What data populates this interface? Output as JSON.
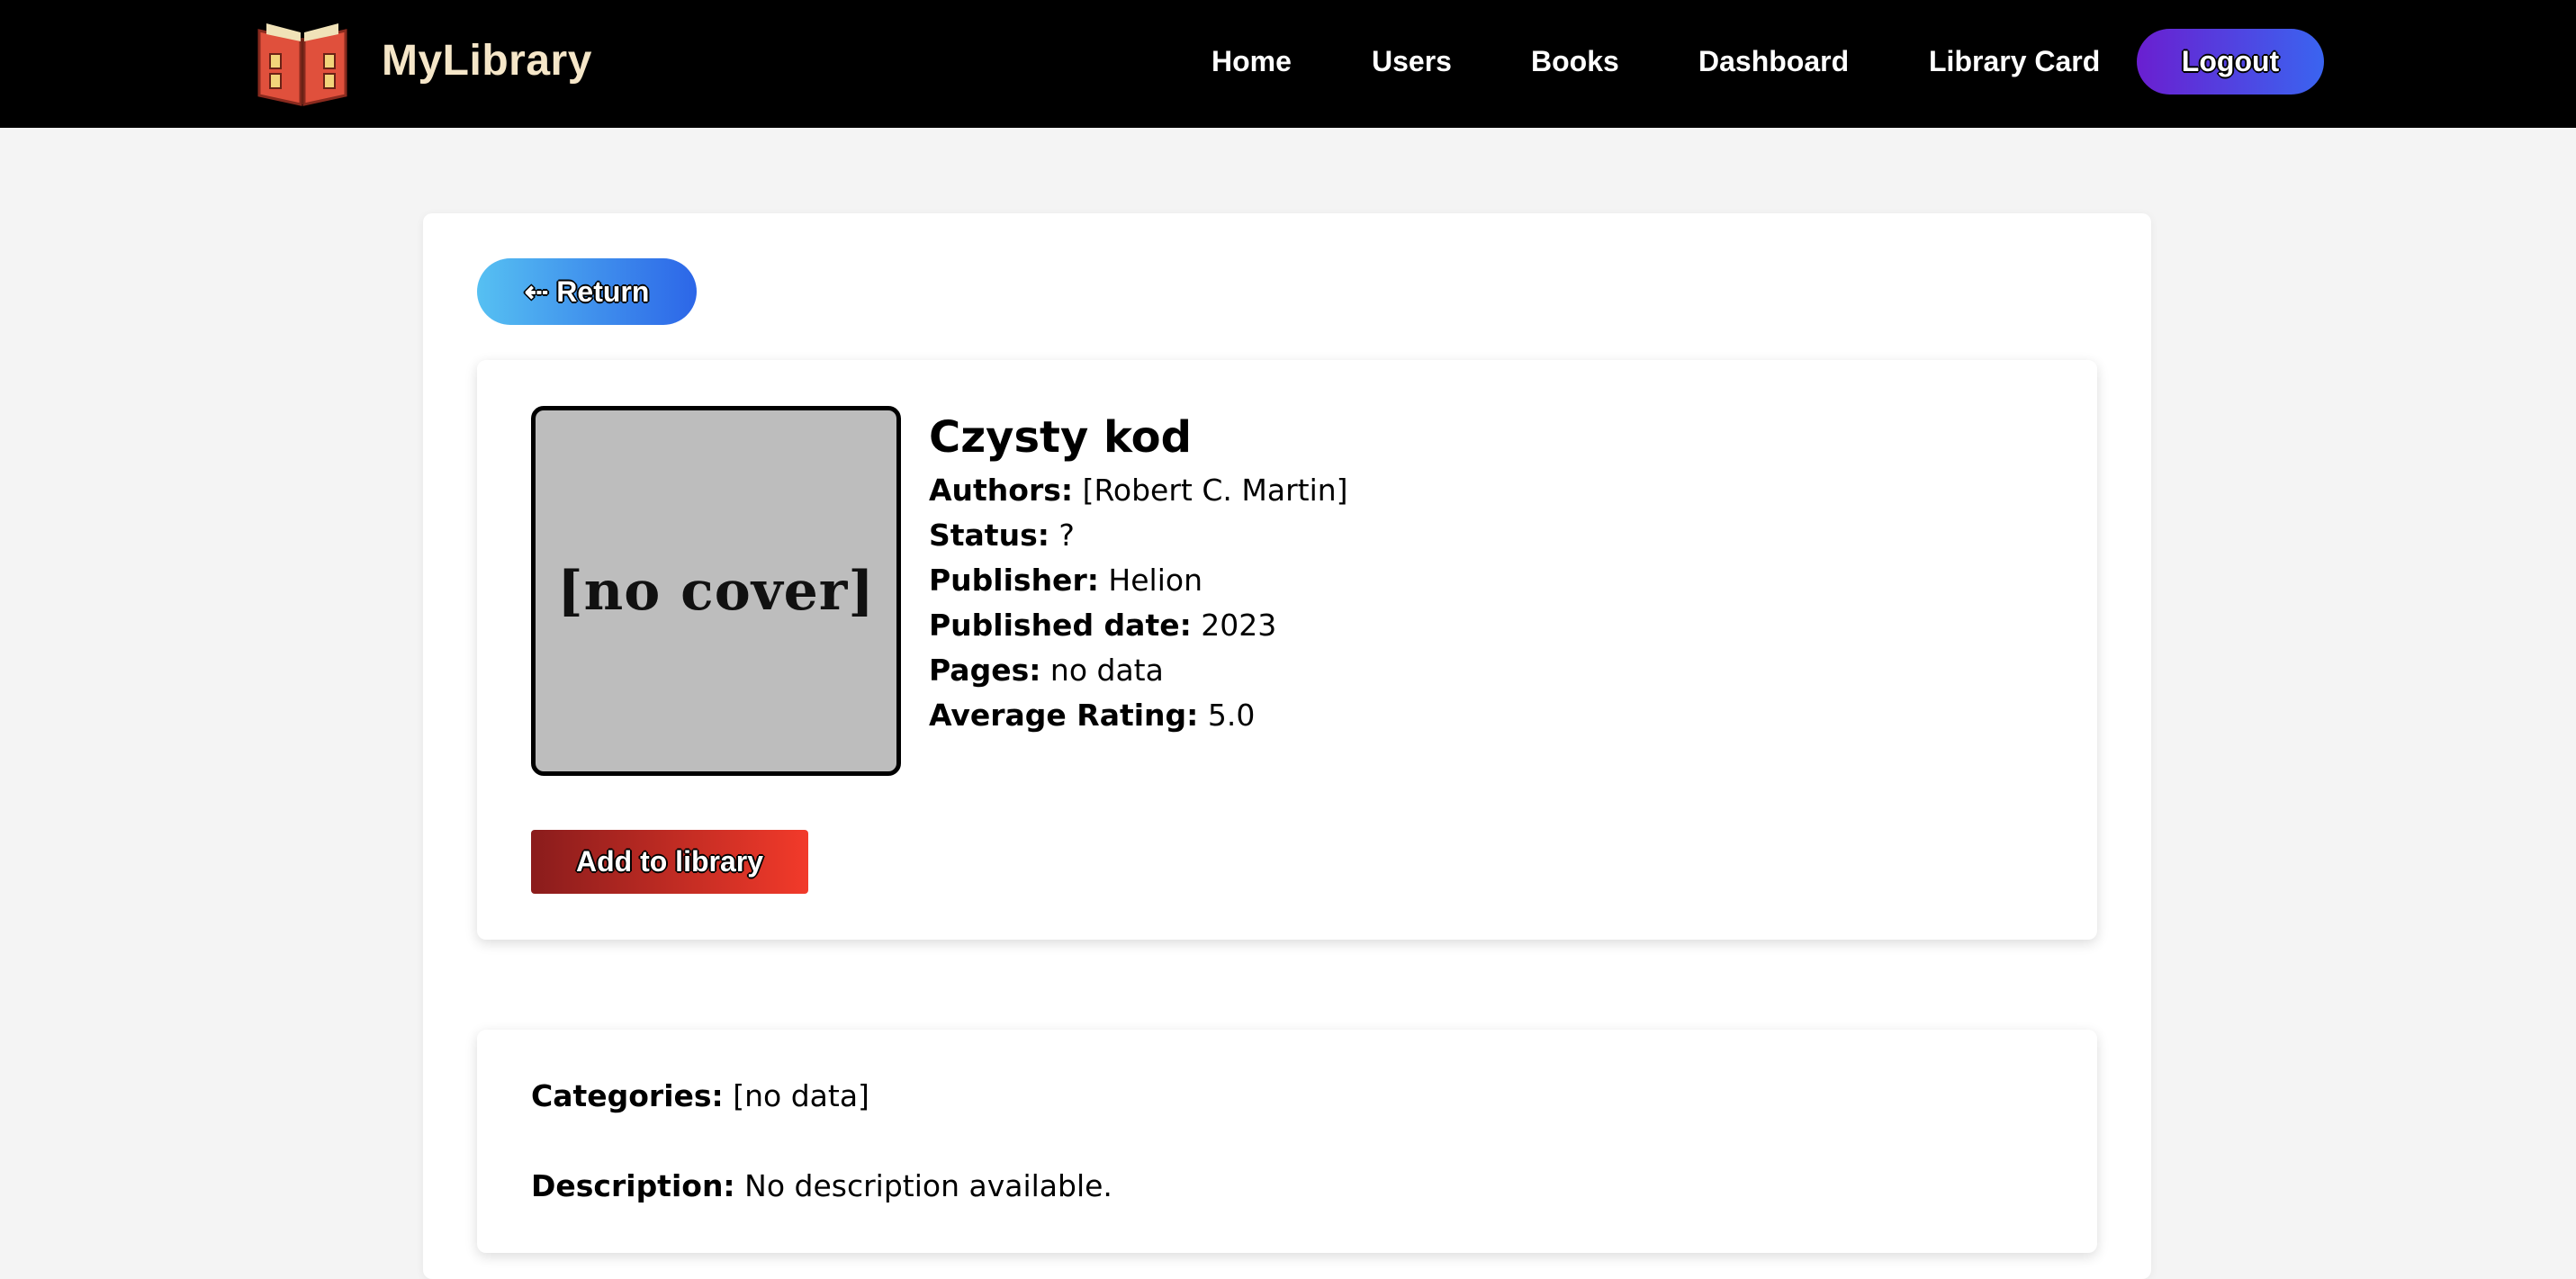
{
  "navbar": {
    "brand": "MyLibrary",
    "logo_icon": "open-book-icon",
    "links": [
      "Home",
      "Users",
      "Books",
      "Dashboard",
      "Library Card"
    ],
    "logout_label": "Logout"
  },
  "colors": {
    "navbar_bg": "#000000",
    "brand_color": "#f5e6c8",
    "logout_gradient": [
      "#6a1fd0",
      "#3a64f0"
    ],
    "return_gradient": [
      "#56c0f2",
      "#2c66e8"
    ],
    "add_gradient": [
      "#8a1c1c",
      "#f23a2a"
    ],
    "cover_bg": "#bdbdbd"
  },
  "book": {
    "return_label": "⇠ Return",
    "cover_text": "[no cover]",
    "title": "Czysty kod",
    "authors_label": "Authors:",
    "authors": "[Robert C. Martin]",
    "status_label": "Status:",
    "status": "?",
    "publisher_label": "Publisher:",
    "publisher": "Helion",
    "published_label": "Published date:",
    "published": "2023",
    "pages_label": "Pages:",
    "pages": "no data",
    "rating_label": "Average Rating:",
    "rating": "5.0",
    "add_label": "Add to library"
  },
  "details": {
    "categories_label": "Categories:",
    "categories": "[no data]",
    "description_label": "Description:",
    "description": "No description available."
  }
}
